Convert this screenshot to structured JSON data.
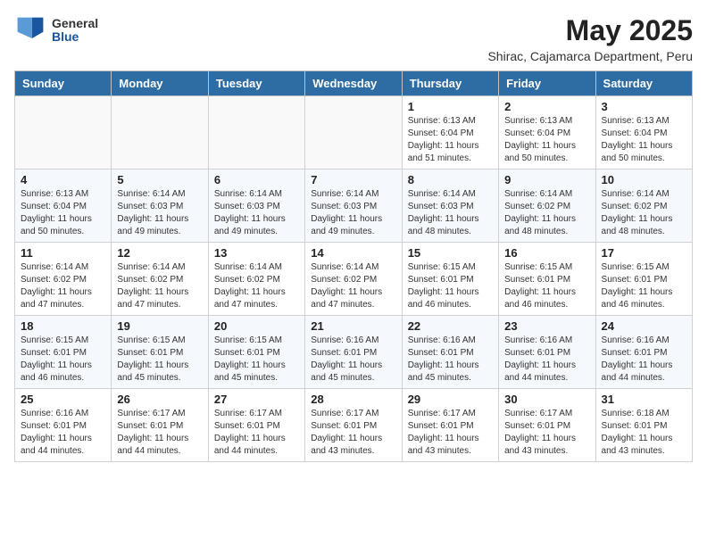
{
  "logo": {
    "general": "General",
    "blue": "Blue"
  },
  "title": "May 2025",
  "subtitle": "Shirac, Cajamarca Department, Peru",
  "weekdays": [
    "Sunday",
    "Monday",
    "Tuesday",
    "Wednesday",
    "Thursday",
    "Friday",
    "Saturday"
  ],
  "weeks": [
    [
      {
        "day": "",
        "content": ""
      },
      {
        "day": "",
        "content": ""
      },
      {
        "day": "",
        "content": ""
      },
      {
        "day": "",
        "content": ""
      },
      {
        "day": "1",
        "content": "Sunrise: 6:13 AM\nSunset: 6:04 PM\nDaylight: 11 hours and 51 minutes."
      },
      {
        "day": "2",
        "content": "Sunrise: 6:13 AM\nSunset: 6:04 PM\nDaylight: 11 hours and 50 minutes."
      },
      {
        "day": "3",
        "content": "Sunrise: 6:13 AM\nSunset: 6:04 PM\nDaylight: 11 hours and 50 minutes."
      }
    ],
    [
      {
        "day": "4",
        "content": "Sunrise: 6:13 AM\nSunset: 6:04 PM\nDaylight: 11 hours and 50 minutes."
      },
      {
        "day": "5",
        "content": "Sunrise: 6:14 AM\nSunset: 6:03 PM\nDaylight: 11 hours and 49 minutes."
      },
      {
        "day": "6",
        "content": "Sunrise: 6:14 AM\nSunset: 6:03 PM\nDaylight: 11 hours and 49 minutes."
      },
      {
        "day": "7",
        "content": "Sunrise: 6:14 AM\nSunset: 6:03 PM\nDaylight: 11 hours and 49 minutes."
      },
      {
        "day": "8",
        "content": "Sunrise: 6:14 AM\nSunset: 6:03 PM\nDaylight: 11 hours and 48 minutes."
      },
      {
        "day": "9",
        "content": "Sunrise: 6:14 AM\nSunset: 6:02 PM\nDaylight: 11 hours and 48 minutes."
      },
      {
        "day": "10",
        "content": "Sunrise: 6:14 AM\nSunset: 6:02 PM\nDaylight: 11 hours and 48 minutes."
      }
    ],
    [
      {
        "day": "11",
        "content": "Sunrise: 6:14 AM\nSunset: 6:02 PM\nDaylight: 11 hours and 47 minutes."
      },
      {
        "day": "12",
        "content": "Sunrise: 6:14 AM\nSunset: 6:02 PM\nDaylight: 11 hours and 47 minutes."
      },
      {
        "day": "13",
        "content": "Sunrise: 6:14 AM\nSunset: 6:02 PM\nDaylight: 11 hours and 47 minutes."
      },
      {
        "day": "14",
        "content": "Sunrise: 6:14 AM\nSunset: 6:02 PM\nDaylight: 11 hours and 47 minutes."
      },
      {
        "day": "15",
        "content": "Sunrise: 6:15 AM\nSunset: 6:01 PM\nDaylight: 11 hours and 46 minutes."
      },
      {
        "day": "16",
        "content": "Sunrise: 6:15 AM\nSunset: 6:01 PM\nDaylight: 11 hours and 46 minutes."
      },
      {
        "day": "17",
        "content": "Sunrise: 6:15 AM\nSunset: 6:01 PM\nDaylight: 11 hours and 46 minutes."
      }
    ],
    [
      {
        "day": "18",
        "content": "Sunrise: 6:15 AM\nSunset: 6:01 PM\nDaylight: 11 hours and 46 minutes."
      },
      {
        "day": "19",
        "content": "Sunrise: 6:15 AM\nSunset: 6:01 PM\nDaylight: 11 hours and 45 minutes."
      },
      {
        "day": "20",
        "content": "Sunrise: 6:15 AM\nSunset: 6:01 PM\nDaylight: 11 hours and 45 minutes."
      },
      {
        "day": "21",
        "content": "Sunrise: 6:16 AM\nSunset: 6:01 PM\nDaylight: 11 hours and 45 minutes."
      },
      {
        "day": "22",
        "content": "Sunrise: 6:16 AM\nSunset: 6:01 PM\nDaylight: 11 hours and 45 minutes."
      },
      {
        "day": "23",
        "content": "Sunrise: 6:16 AM\nSunset: 6:01 PM\nDaylight: 11 hours and 44 minutes."
      },
      {
        "day": "24",
        "content": "Sunrise: 6:16 AM\nSunset: 6:01 PM\nDaylight: 11 hours and 44 minutes."
      }
    ],
    [
      {
        "day": "25",
        "content": "Sunrise: 6:16 AM\nSunset: 6:01 PM\nDaylight: 11 hours and 44 minutes."
      },
      {
        "day": "26",
        "content": "Sunrise: 6:17 AM\nSunset: 6:01 PM\nDaylight: 11 hours and 44 minutes."
      },
      {
        "day": "27",
        "content": "Sunrise: 6:17 AM\nSunset: 6:01 PM\nDaylight: 11 hours and 44 minutes."
      },
      {
        "day": "28",
        "content": "Sunrise: 6:17 AM\nSunset: 6:01 PM\nDaylight: 11 hours and 43 minutes."
      },
      {
        "day": "29",
        "content": "Sunrise: 6:17 AM\nSunset: 6:01 PM\nDaylight: 11 hours and 43 minutes."
      },
      {
        "day": "30",
        "content": "Sunrise: 6:17 AM\nSunset: 6:01 PM\nDaylight: 11 hours and 43 minutes."
      },
      {
        "day": "31",
        "content": "Sunrise: 6:18 AM\nSunset: 6:01 PM\nDaylight: 11 hours and 43 minutes."
      }
    ]
  ]
}
